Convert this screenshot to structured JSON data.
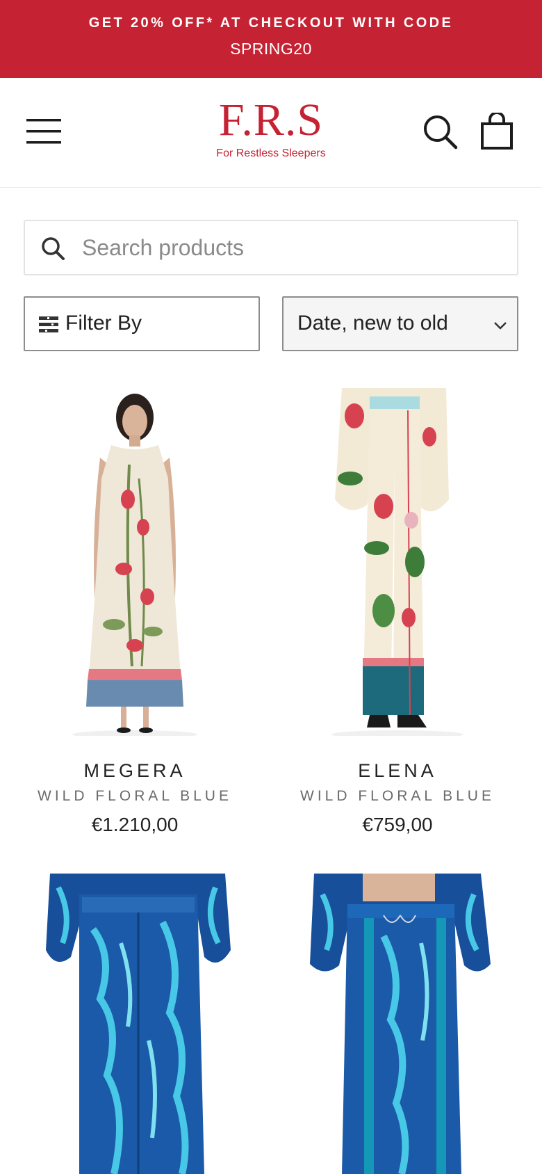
{
  "promo": {
    "line1": "GET 20% OFF* AT CHECKOUT WITH CODE",
    "line2": "SPRING20"
  },
  "header": {
    "logo_mark": "F.R.S",
    "logo_tagline": "For Restless Sleepers",
    "menu_icon": "menu-icon",
    "search_icon": "search-icon",
    "cart_icon": "cart-icon"
  },
  "search": {
    "placeholder": "Search products"
  },
  "filters": {
    "filter_label": "Filter By",
    "sort_selected": "Date, new to old"
  },
  "products": [
    {
      "name": "MEGERA",
      "variant": "WILD FLORAL BLUE",
      "price": "€1.210,00"
    },
    {
      "name": "ELENA",
      "variant": "WILD FLORAL BLUE",
      "price": "€759,00"
    },
    {
      "name": "",
      "variant": "",
      "price": ""
    },
    {
      "name": "",
      "variant": "",
      "price": ""
    }
  ],
  "colors": {
    "brand_red": "#c52233",
    "text_dark": "#1c1c1c",
    "text_muted": "#6b6b6b",
    "border": "#8d8d8d"
  }
}
